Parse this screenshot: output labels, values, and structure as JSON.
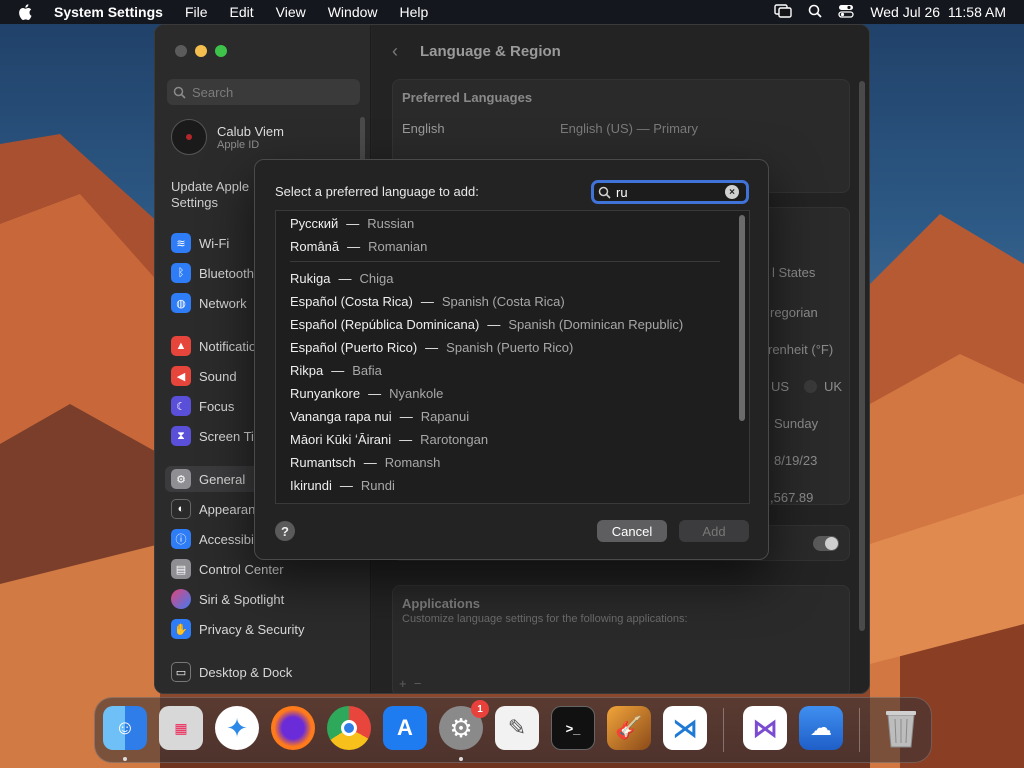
{
  "menubar": {
    "app_name": "System Settings",
    "items": [
      "File",
      "Edit",
      "View",
      "Window",
      "Help"
    ],
    "datetime": "Wed Jul 26  11:58 AM"
  },
  "sidebar": {
    "search_placeholder": "Search",
    "account": {
      "name": "Calub Viem",
      "subtitle": "Apple ID"
    },
    "update_label": "Update Apple Settings",
    "items": [
      {
        "label": "Wi-Fi",
        "icon": "wifi-icon",
        "color": "#2e7cf6"
      },
      {
        "label": "Bluetooth",
        "icon": "bluetooth-icon",
        "color": "#2e7cf6"
      },
      {
        "label": "Network",
        "icon": "globe-icon",
        "color": "#2e7cf6"
      },
      {
        "label": "Notifications",
        "icon": "bell-icon",
        "color": "#e6453c"
      },
      {
        "label": "Sound",
        "icon": "speaker-icon",
        "color": "#e6453c"
      },
      {
        "label": "Focus",
        "icon": "moon-icon",
        "color": "#5a4fd8"
      },
      {
        "label": "Screen Time",
        "icon": "hourglass-icon",
        "color": "#5a4fd8"
      },
      {
        "label": "General",
        "icon": "gear-icon",
        "color": "#8e8e93"
      },
      {
        "label": "Appearance",
        "icon": "appearance-icon",
        "color": "#2a2a2a"
      },
      {
        "label": "Accessibility",
        "icon": "accessibility-icon",
        "color": "#2e7cf6"
      },
      {
        "label": "Control Center",
        "icon": "control-center-icon",
        "color": "#8e8e93"
      },
      {
        "label": "Siri & Spotlight",
        "icon": "siri-icon",
        "color": "#b347d8"
      },
      {
        "label": "Privacy & Security",
        "icon": "hand-icon",
        "color": "#2e7cf6"
      },
      {
        "label": "Desktop & Dock",
        "icon": "dock-icon",
        "color": "#2a2a2a"
      }
    ]
  },
  "main": {
    "title": "Language & Region",
    "preferred_header": "Preferred Languages",
    "lang_row": {
      "name": "English",
      "detail": "English (US) — Primary"
    },
    "right_values": [
      "l States",
      "regorian",
      "renheit (°F)",
      "US",
      "UK",
      "Sunday",
      "8/19/23",
      ",567.89"
    ],
    "apps_title": "Applications",
    "apps_desc": "Customize language settings for the following applications:",
    "add_remove": "+  −"
  },
  "dialog": {
    "title": "Select a preferred language to add:",
    "search_value": "ru",
    "languages_top": [
      {
        "native": "Русский",
        "english": "Russian"
      },
      {
        "native": "Română",
        "english": "Romanian"
      }
    ],
    "languages": [
      {
        "native": "Rukiga",
        "english": "Chiga"
      },
      {
        "native": "Español (Costa Rica)",
        "english": "Spanish (Costa Rica)"
      },
      {
        "native": "Español (República Dominicana)",
        "english": "Spanish (Dominican Republic)"
      },
      {
        "native": "Español (Puerto Rico)",
        "english": "Spanish (Puerto Rico)"
      },
      {
        "native": "Rikpa",
        "english": "Bafia"
      },
      {
        "native": "Runyankore",
        "english": "Nyankole"
      },
      {
        "native": "Vananga rapa nui",
        "english": "Rapanui"
      },
      {
        "native": "Māori Kūki ʻĀirani",
        "english": "Rarotongan"
      },
      {
        "native": "Rumantsch",
        "english": "Romansh"
      },
      {
        "native": "Ikirundi",
        "english": "Rundi"
      }
    ],
    "dash": "—",
    "help_label": "?",
    "cancel_label": "Cancel",
    "add_label": "Add"
  },
  "dock": {
    "apps": [
      {
        "name": "Finder",
        "color": "#2f8cf0"
      },
      {
        "name": "Launchpad",
        "color": "#d8d8d8"
      },
      {
        "name": "Safari",
        "color": "#2d89e8"
      },
      {
        "name": "Firefox",
        "color": "#ff7a1a"
      },
      {
        "name": "Chrome",
        "color": "#ffffff"
      },
      {
        "name": "App Store",
        "color": "#1f7cf0"
      },
      {
        "name": "System Settings",
        "color": "#8a8a8a",
        "badge": "1"
      },
      {
        "name": "TextEdit",
        "color": "#f2f2f2"
      },
      {
        "name": "Terminal",
        "color": "#111111"
      },
      {
        "name": "GarageBand",
        "color": "#e08a2a"
      },
      {
        "name": "Visual Studio Code",
        "color": "#ffffff"
      },
      {
        "name": "Visual Studio",
        "color": "#ffffff"
      },
      {
        "name": "Weather",
        "color": "#2f7ee6"
      },
      {
        "name": "Trash",
        "color": "#bdbdbd"
      }
    ],
    "terminal_glyph": ">_"
  }
}
